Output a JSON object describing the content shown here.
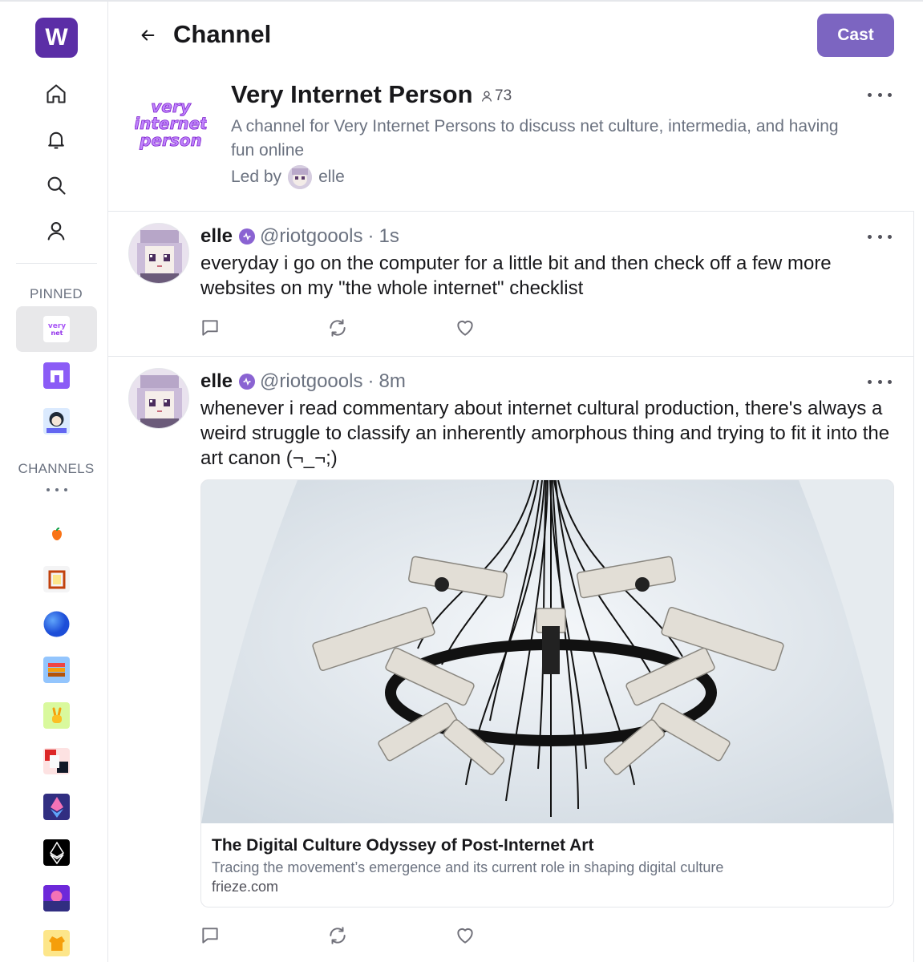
{
  "app": {
    "logo_letter": "W",
    "accent": "#7c65c1",
    "logo_bg": "#5b2ea6"
  },
  "sidebar": {
    "nav": [
      {
        "name": "home",
        "icon": "home-icon"
      },
      {
        "name": "notifications",
        "icon": "bell-icon"
      },
      {
        "name": "search",
        "icon": "search-icon"
      },
      {
        "name": "profile",
        "icon": "user-icon"
      }
    ],
    "pinned_label": "PINNED",
    "channels_label": "CHANNELS",
    "pinned": [
      "very-internet-person",
      "purple-n-channel",
      "manga-channel"
    ],
    "channels": [
      "apple-emoji",
      "frame-emoji",
      "blue-circle-emoji",
      "pixel-art",
      "peace-emoji",
      "abstract-art",
      "ethereum-color",
      "ethereum-black",
      "synthwave",
      "jacket-emoji"
    ]
  },
  "header": {
    "title": "Channel",
    "cast_button": "Cast"
  },
  "channel": {
    "logo_text": "Very Internet Person",
    "name": "Very Internet Person",
    "member_count": "73",
    "description": "A channel for Very Internet Persons to discuss net culture, intermedia, and having fun online",
    "led_by_label": "Led by",
    "lead": "elle"
  },
  "casts": [
    {
      "author": "elle",
      "handle": "@riotgoools",
      "separator": "·",
      "time": "1s",
      "text": "everyday i go on the computer for a little bit and then check off a few more websites on my \"the whole internet\" checklist"
    },
    {
      "author": "elle",
      "handle": "@riotgoools",
      "separator": "·",
      "time": "8m",
      "text": "whenever i read commentary about internet cultural production, there's always a weird struggle to classify an inherently amorphous thing and trying to fit it into the art canon (¬_¬;)",
      "embed": {
        "title": "The Digital Culture Odyssey of Post-Internet Art",
        "description": "Tracing the movement’s emergence and its current role in shaping digital culture",
        "domain": "frieze.com"
      }
    }
  ]
}
